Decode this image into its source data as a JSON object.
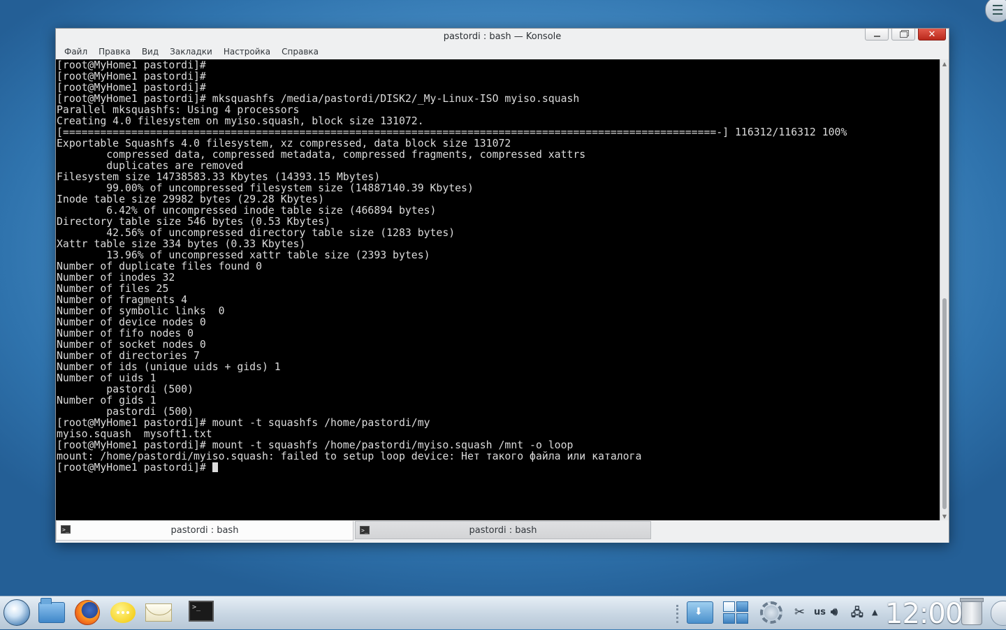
{
  "window": {
    "title": "pastordi : bash — Konsole",
    "buttons": {
      "minimize": "minimize",
      "maximize": "maximize",
      "close": "✕"
    }
  },
  "menubar": {
    "items": [
      {
        "label": "Файл"
      },
      {
        "label": "Правка"
      },
      {
        "label": "Вид"
      },
      {
        "label": "Закладки"
      },
      {
        "label": "Настройка"
      },
      {
        "label": "Справка"
      }
    ]
  },
  "terminal": {
    "lines": [
      "[root@MyHome1 pastordi]#",
      "[root@MyHome1 pastordi]#",
      "[root@MyHome1 pastordi]#",
      "[root@MyHome1 pastordi]# mksquashfs /media/pastordi/DISK2/_My-Linux-ISO myiso.squash",
      "Parallel mksquashfs: Using 4 processors",
      "Creating 4.0 filesystem on myiso.squash, block size 131072.",
      "[=========================================================================================================-] 116312/116312 100%",
      "Exportable Squashfs 4.0 filesystem, xz compressed, data block size 131072",
      "        compressed data, compressed metadata, compressed fragments, compressed xattrs",
      "        duplicates are removed",
      "Filesystem size 14738583.33 Kbytes (14393.15 Mbytes)",
      "        99.00% of uncompressed filesystem size (14887140.39 Kbytes)",
      "Inode table size 29982 bytes (29.28 Kbytes)",
      "        6.42% of uncompressed inode table size (466894 bytes)",
      "Directory table size 546 bytes (0.53 Kbytes)",
      "        42.56% of uncompressed directory table size (1283 bytes)",
      "Xattr table size 334 bytes (0.33 Kbytes)",
      "        13.96% of uncompressed xattr table size (2393 bytes)",
      "Number of duplicate files found 0",
      "Number of inodes 32",
      "Number of files 25",
      "Number of fragments 4",
      "Number of symbolic links  0",
      "Number of device nodes 0",
      "Number of fifo nodes 0",
      "Number of socket nodes 0",
      "Number of directories 7",
      "Number of ids (unique uids + gids) 1",
      "Number of uids 1",
      "        pastordi (500)",
      "Number of gids 1",
      "        pastordi (500)",
      "[root@MyHome1 pastordi]# mount -t squashfs /home/pastordi/my",
      "myiso.squash  mysoft1.txt",
      "[root@MyHome1 pastordi]# mount -t squashfs /home/pastordi/myiso.squash /mnt -o loop",
      "mount: /home/pastordi/myiso.squash: failed to setup loop device: Нет такого файла или каталога"
    ],
    "prompt": "[root@MyHome1 pastordi]# ",
    "text_color": "#dcdcdc",
    "background_color": "#000000"
  },
  "tabs": [
    {
      "label": "pastordi : bash",
      "active": true,
      "icon": "terminal-icon"
    },
    {
      "label": "pastordi : bash",
      "active": false,
      "icon": "terminal-icon"
    }
  ],
  "taskbar": {
    "icons": [
      "kde-launcher-icon",
      "file-manager-icon",
      "firefox-icon",
      "chat-icon",
      "mail-icon",
      "konsole-icon"
    ],
    "tray": {
      "keyboard_layout": "us",
      "clock": "12:00"
    }
  }
}
